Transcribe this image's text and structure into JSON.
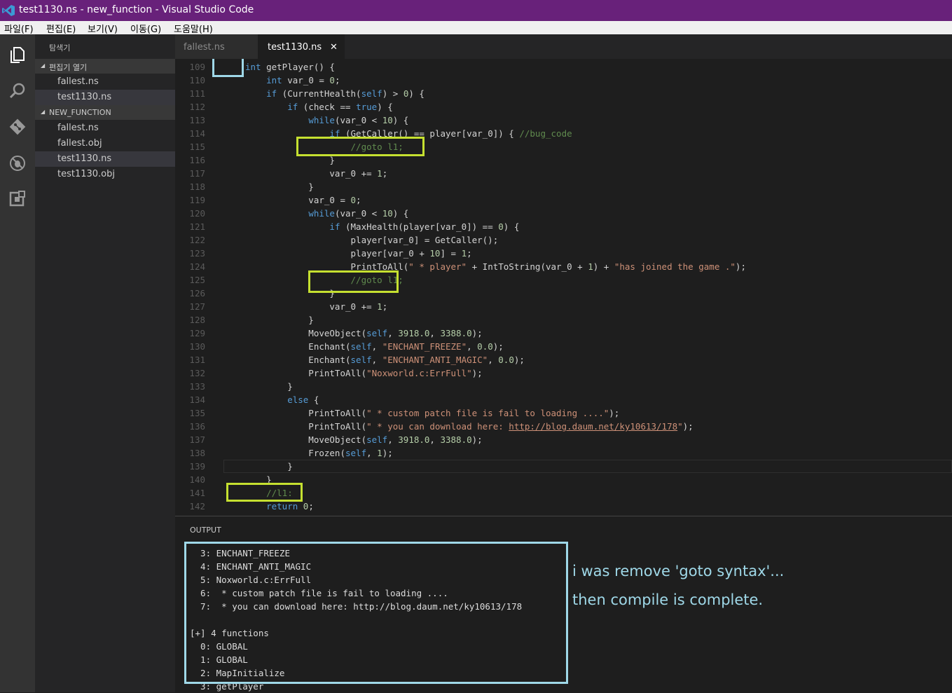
{
  "window": {
    "title": "test1130.ns - new_function - Visual Studio Code"
  },
  "menu": [
    "파일(F)",
    "편집(E)",
    "보기(V)",
    "이동(G)",
    "도움말(H)"
  ],
  "activity_icons": [
    "files-icon",
    "search-icon",
    "git-icon",
    "debug-icon",
    "extensions-icon"
  ],
  "explorer": {
    "header": "탐색기",
    "open_editors": {
      "label": "편집기 열기",
      "items": [
        "fallest.ns",
        "test1130.ns"
      ]
    },
    "project": {
      "label": "NEW_FUNCTION",
      "items": [
        "fallest.ns",
        "fallest.obj",
        "test1130.ns",
        "test1130.obj"
      ]
    }
  },
  "tabs": [
    {
      "label": "fallest.ns",
      "active": false
    },
    {
      "label": "test1130.ns",
      "active": true,
      "close": "✕"
    }
  ],
  "editor": {
    "lines": [
      {
        "n": "109",
        "code": "int getPlayer() {"
      },
      {
        "n": "110",
        "code": "    int var_0 = 0;"
      },
      {
        "n": "111",
        "code": "    if (CurrentHealth(self) > 0) {"
      },
      {
        "n": "112",
        "code": "        if (check == true) {"
      },
      {
        "n": "113",
        "code": "            while(var_0 < 10) {"
      },
      {
        "n": "114",
        "code": "                if (GetCaller() == player[var_0]) { //bug_code"
      },
      {
        "n": "115",
        "code": "                    //goto l1;"
      },
      {
        "n": "116",
        "code": "                }"
      },
      {
        "n": "117",
        "code": "                var_0 += 1;"
      },
      {
        "n": "118",
        "code": "            }"
      },
      {
        "n": "119",
        "code": "            var_0 = 0;"
      },
      {
        "n": "120",
        "code": "            while(var_0 < 10) {"
      },
      {
        "n": "121",
        "code": "                if (MaxHealth(player[var_0]) == 0) {"
      },
      {
        "n": "122",
        "code": "                    player[var_0] = GetCaller();"
      },
      {
        "n": "123",
        "code": "                    player[var_0 + 10] = 1;"
      },
      {
        "n": "124",
        "code": "                    PrintToAll(\" * player\" + IntToString(var_0 + 1) + \"has joined the game .\");"
      },
      {
        "n": "125",
        "code": "                    //goto l1;"
      },
      {
        "n": "126",
        "code": "                }"
      },
      {
        "n": "127",
        "code": "                var_0 += 1;"
      },
      {
        "n": "128",
        "code": "            }"
      },
      {
        "n": "129",
        "code": "            MoveObject(self, 3918.0, 3388.0);"
      },
      {
        "n": "130",
        "code": "            Enchant(self, \"ENCHANT_FREEZE\", 0.0);"
      },
      {
        "n": "131",
        "code": "            Enchant(self, \"ENCHANT_ANTI_MAGIC\", 0.0);"
      },
      {
        "n": "132",
        "code": "            PrintToAll(\"Noxworld.c:ErrFull\");"
      },
      {
        "n": "133",
        "code": "        }"
      },
      {
        "n": "134",
        "code": "        else {"
      },
      {
        "n": "135",
        "code": "            PrintToAll(\" * custom patch file is fail to loading ....\");"
      },
      {
        "n": "136",
        "code": "            PrintToAll(\" * you can download here: http://blog.daum.net/ky10613/178\");"
      },
      {
        "n": "137",
        "code": "            MoveObject(self, 3918.0, 3388.0);"
      },
      {
        "n": "138",
        "code": "            Frozen(self, 1);"
      },
      {
        "n": "139",
        "code": "        }"
      },
      {
        "n": "140",
        "code": "    }"
      },
      {
        "n": "141",
        "code": "    //l1:"
      },
      {
        "n": "142",
        "code": "    return 0;"
      }
    ]
  },
  "output": {
    "title": "OUTPUT",
    "lines": [
      "  3: ENCHANT_FREEZE",
      "  4: ENCHANT_ANTI_MAGIC",
      "  5: Noxworld.c:ErrFull",
      "  6:  * custom patch file is fail to loading ....",
      "  7:  * you can download here: http://blog.daum.net/ky10613/178",
      "",
      "[+] 4 functions",
      "  0: GLOBAL",
      "  1: GLOBAL",
      "  2: MapInitialize",
      "  3: getPlayer"
    ]
  },
  "annotation": {
    "line1": "i was remove 'goto syntax'...",
    "line2": "then compile is complete."
  },
  "colors": {
    "titlebar": "#68217a",
    "highlight": "#c5e030",
    "annotation": "#9fd8e8"
  }
}
